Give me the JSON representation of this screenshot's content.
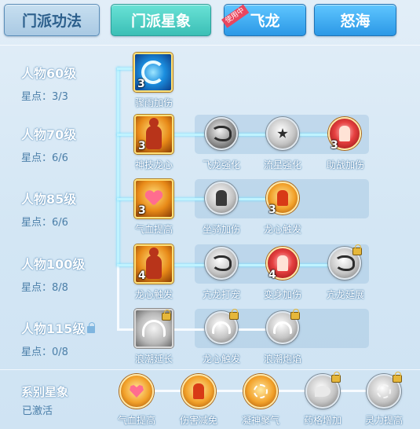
{
  "tabs": [
    {
      "label": "门派功法",
      "active": false
    },
    {
      "label": "门派星象",
      "active": true
    },
    {
      "label": "飞龙",
      "active": false,
      "badge": "使用中"
    },
    {
      "label": "怒海",
      "active": false
    }
  ],
  "levels": [
    {
      "title": "人物60级",
      "stars": "星点：3/3",
      "locked": false
    },
    {
      "title": "人物70级",
      "stars": "星点：6/6",
      "locked": false
    },
    {
      "title": "人物85级",
      "stars": "星点：6/6",
      "locked": false
    },
    {
      "title": "人物100级",
      "stars": "星点：8/8",
      "locked": false
    },
    {
      "title": "人物115级",
      "stars": "星点：0/8",
      "locked": true
    }
  ],
  "tree": {
    "row1": {
      "main": {
        "label": "骤雨加伤",
        "level": "3",
        "icon": "storm-swirl-icon"
      }
    },
    "row2": {
      "main": {
        "label": "神技龙心",
        "level": "3",
        "icon": "dragon-heart-figure-icon"
      },
      "subs": [
        {
          "label": "飞龙强化",
          "level": "",
          "icon": "dragon-icon",
          "locked": false
        },
        {
          "label": "流星强化",
          "level": "",
          "icon": "meteor-star-icon",
          "locked": false
        },
        {
          "label": "助战加伤",
          "level": "3",
          "icon": "assist-damage-icon",
          "locked": false
        }
      ]
    },
    "row3": {
      "main": {
        "label": "气血提高",
        "level": "3",
        "icon": "heart-icon"
      },
      "subs": [
        {
          "label": "坐骑加伤",
          "level": "",
          "icon": "mount-icon",
          "locked": false
        },
        {
          "label": "龙心触发",
          "level": "3",
          "icon": "dragon-heart-trigger-icon",
          "locked": false
        }
      ]
    },
    "row4": {
      "main": {
        "label": "龙心触发",
        "level": "4",
        "icon": "dragon-heart-figure-icon"
      },
      "subs": [
        {
          "label": "亢龙打宠",
          "level": "",
          "icon": "dragon-icon",
          "locked": false
        },
        {
          "label": "变身加伤",
          "level": "4",
          "icon": "transform-icon",
          "locked": false
        },
        {
          "label": "亢龙延展",
          "level": "",
          "icon": "dragon-icon",
          "locked": true
        }
      ]
    },
    "row5": {
      "main": {
        "label": "浪潮延长",
        "level": "",
        "icon": "wave-icon",
        "locked": true
      },
      "subs": [
        {
          "label": "龙心触发",
          "level": "",
          "icon": "wave-icon",
          "locked": true
        },
        {
          "label": "浪潮炮焰",
          "level": "",
          "icon": "wave-icon",
          "locked": true
        }
      ]
    }
  },
  "series": {
    "title": "系别星象",
    "status": "已激活",
    "items": [
      {
        "label": "气血提高",
        "icon": "heart-icon",
        "locked": false
      },
      {
        "label": "伤害减免",
        "icon": "defense-figure-icon",
        "locked": false
      },
      {
        "label": "凝神聚气",
        "icon": "focus-snowflake-icon",
        "locked": false
      },
      {
        "label": "药格增加",
        "icon": "medicine-leaf-icon",
        "locked": true
      },
      {
        "label": "灵力提高",
        "icon": "spirit-power-icon",
        "locked": true
      }
    ]
  },
  "colors": {
    "background": "#d9eaf6",
    "active_tab": "#4fd0c6",
    "school_tab": "#3aa6ef",
    "badge": "#e9465e",
    "level_text": "#4a7ea8"
  }
}
